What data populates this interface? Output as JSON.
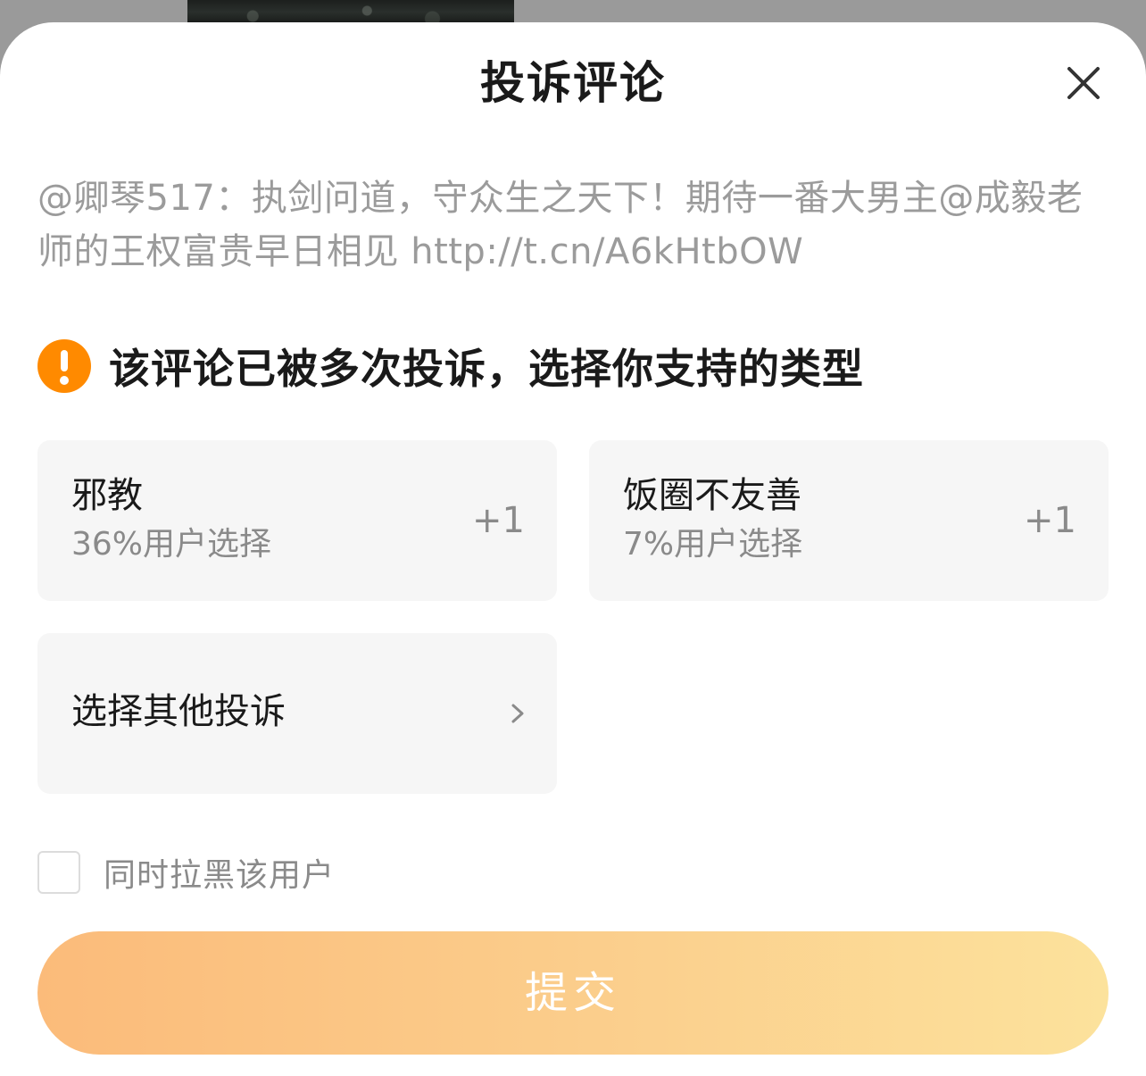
{
  "dialog": {
    "title": "投诉评论",
    "close_icon": "close-icon"
  },
  "comment": {
    "text": "@卿琴517：执剑问道，守众生之天下！期待一番大男主@成毅老师的王权富贵早日相见 http://t.cn/A6kHtbOW"
  },
  "notice": {
    "icon": "warning-icon",
    "icon_color": "#ff8a00",
    "text": "该评论已被多次投诉，选择你支持的类型"
  },
  "options": [
    {
      "label": "邪教",
      "percent_text": "36%用户选择",
      "vote_label": "+1"
    },
    {
      "label": "饭圈不友善",
      "percent_text": "7%用户选择",
      "vote_label": "+1"
    }
  ],
  "other_option": {
    "label": "选择其他投诉",
    "icon": "chevron-right-icon"
  },
  "blacklist": {
    "label": "同时拉黑该用户",
    "checked": false
  },
  "submit": {
    "label": "提交",
    "enabled": false,
    "gradient": [
      "#fbbb7a",
      "#fce29c"
    ]
  }
}
